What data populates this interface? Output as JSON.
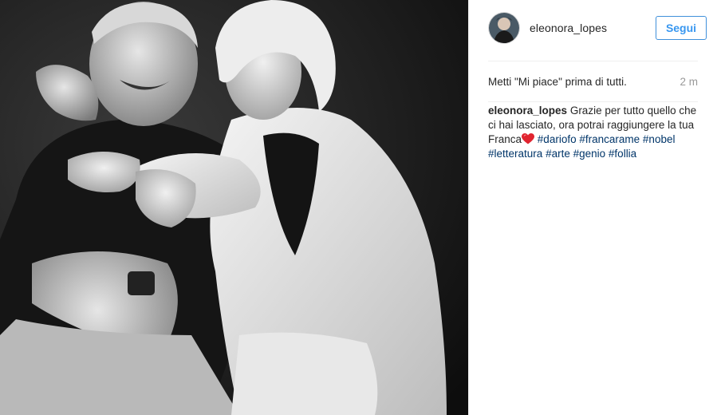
{
  "post": {
    "photo_alt_icon": "photo",
    "header": {
      "username": "eleonora_lopes",
      "follow_label": "Segui"
    },
    "likes": {
      "text": "Metti \"Mi piace\" prima di tutti.",
      "time": "2 m"
    },
    "caption": {
      "author": "eleonora_lopes",
      "text_before_heart": "Grazie per tutto quello che ci hai lasciato, ora potrai raggiungere la tua Franca",
      "heart_icon": "red-heart-emoji",
      "hashtags": [
        "#dariofo",
        "#francarame",
        "#nobel",
        "#letteratura",
        "#arte",
        "#genio",
        "#follia"
      ]
    },
    "colors": {
      "link_blue": "#3897f0",
      "hashtag_navy": "#003569",
      "timestamp_gray": "#999999",
      "heart_red": "#e0242f"
    }
  }
}
